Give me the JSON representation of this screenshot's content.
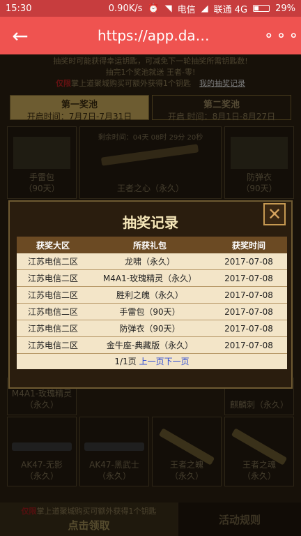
{
  "status_bar": {
    "time": "15:30",
    "speed": "0.90K/s",
    "carrier1": "电信",
    "carrier2": "联通 4G",
    "battery": "29%"
  },
  "app_bar": {
    "url": "https://app.da…",
    "back_icon": "back-arrow-icon",
    "more_icon": "more-dots-icon"
  },
  "background": {
    "notice_line1": "抽奖时可能获得幸运钥匙，可减免下一轮抽奖所需钥匙数!",
    "notice_line2": "抽完1个奖池就送 王者-零!",
    "notice_red": "仅限",
    "notice_line3": "掌上道聚城购买可额外获得1个钥匙",
    "notice_link": "我的抽奖记录",
    "pool1": {
      "name": "第一奖池",
      "date": "开启时间：7月7日-7月31日"
    },
    "pool2": {
      "name": "第二奖池",
      "date": "开启 时间：8月1日-8月27日"
    },
    "countdown": "剩余时间：04天 08时 29分 20秒",
    "items": [
      {
        "label": "手雷包",
        "sub": "（90天）"
      },
      {
        "label": "王者之心（永久）",
        "sub": ""
      },
      {
        "label": "防弹衣",
        "sub": "（90天）"
      },
      {
        "label": "M4A1-玫瑰精灵",
        "sub": "（永久）"
      },
      {
        "label": "麒麟刺（永久）",
        "sub": ""
      },
      {
        "label": "AK47-无影",
        "sub": "（永久）"
      },
      {
        "label": "AK47-黑武士",
        "sub": "（永久）"
      },
      {
        "label": "王者之魄",
        "sub": "（永久）"
      },
      {
        "label": "王者之魂",
        "sub": "（永久）"
      }
    ],
    "bottom_red": "仅限",
    "bottom_text": "掌上道聚城购买可额外获得1个钥匙",
    "claim_label": "点击领取",
    "rules_label": "活动规则"
  },
  "modal": {
    "title": "抽奖记录",
    "close_icon": "close-x-icon",
    "headers": [
      "获奖大区",
      "所获礼包",
      "获奖时间"
    ],
    "rows": [
      [
        "江苏电信二区",
        "龙啸（永久）",
        "2017-07-08"
      ],
      [
        "江苏电信二区",
        "M4A1-玫瑰精灵（永久）",
        "2017-07-08"
      ],
      [
        "江苏电信二区",
        "胜利之魄（永久）",
        "2017-07-08"
      ],
      [
        "江苏电信二区",
        "手雷包（90天）",
        "2017-07-08"
      ],
      [
        "江苏电信二区",
        "防弹衣（90天）",
        "2017-07-08"
      ],
      [
        "江苏电信二区",
        "金牛座-典藏版（永久）",
        "2017-07-08"
      ]
    ],
    "pager": {
      "page": "1/1页",
      "prev": "上一页",
      "next": "下一页"
    }
  }
}
